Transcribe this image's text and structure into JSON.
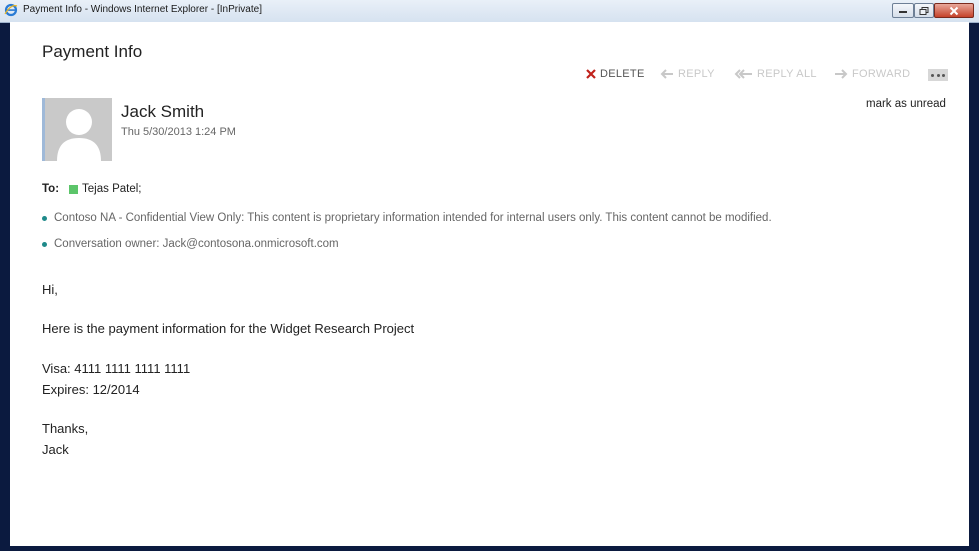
{
  "window": {
    "title": "Payment Info - Windows Internet Explorer - [InPrivate]"
  },
  "email": {
    "subject": "Payment Info",
    "toolbar": {
      "delete": "DELETE",
      "reply": "REPLY",
      "reply_all": "REPLY ALL",
      "forward": "FORWARD"
    },
    "mark_unread": "mark as unread",
    "sender_name": "Jack Smith",
    "sent_date": "Thu 5/30/2013 1:24 PM",
    "to_label": "To:",
    "recipient": "Tejas Patel;",
    "policy_lines": [
      "Contoso NA - Confidential View Only: This content is proprietary information intended for internal users only. This content cannot be modified.",
      "Conversation owner: Jack@contosona.onmicrosoft.com"
    ],
    "body": {
      "greeting": "Hi,",
      "line1": "Here is the payment information for the Widget Research Project",
      "visa": "Visa: 4111 1111 1111 1111",
      "expires": "Expires: 12/2014",
      "thanks": "Thanks,",
      "signature": "Jack"
    }
  },
  "colors": {
    "desktop": "#0b1a3f",
    "presence": "#5cc56a",
    "delete_x": "#c0221b",
    "bullet": "#1f8a8a"
  }
}
